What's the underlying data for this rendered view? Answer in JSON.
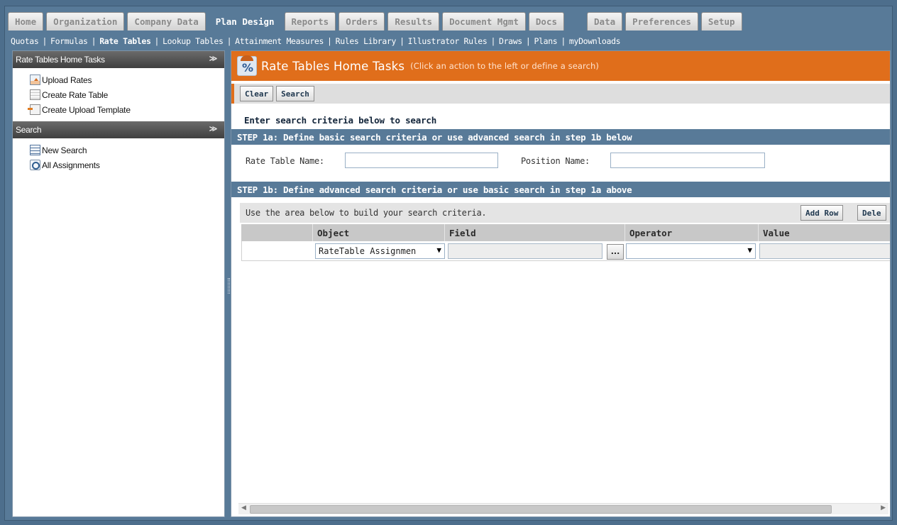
{
  "tabs": [
    {
      "label": "Home",
      "active": false
    },
    {
      "label": "Organization",
      "active": false
    },
    {
      "label": "Company Data",
      "active": false
    },
    {
      "label": "Plan Design",
      "active": true
    },
    {
      "label": "Reports",
      "active": false
    },
    {
      "label": "Orders",
      "active": false
    },
    {
      "label": "Results",
      "active": false
    },
    {
      "label": "Document Mgmt",
      "active": false
    },
    {
      "label": "Docs",
      "active": false
    },
    {
      "label": "Data",
      "active": false
    },
    {
      "label": "Preferences",
      "active": false
    },
    {
      "label": "Setup",
      "active": false
    }
  ],
  "subnav": [
    {
      "label": "Quotas",
      "current": false
    },
    {
      "label": "Formulas",
      "current": false
    },
    {
      "label": "Rate Tables",
      "current": true
    },
    {
      "label": "Lookup Tables",
      "current": false
    },
    {
      "label": "Attainment Measures",
      "current": false
    },
    {
      "label": "Rules Library",
      "current": false
    },
    {
      "label": "Illustrator Rules",
      "current": false
    },
    {
      "label": "Draws",
      "current": false
    },
    {
      "label": "Plans",
      "current": false
    },
    {
      "label": "myDownloads",
      "current": false
    }
  ],
  "left": {
    "tasks_header": "Rate Tables Home Tasks",
    "tasks": [
      {
        "label": "Upload Rates",
        "icon": "upload-icon"
      },
      {
        "label": "Create Rate Table",
        "icon": "document-icon"
      },
      {
        "label": "Create Upload Template",
        "icon": "template-icon"
      }
    ],
    "search_header": "Search",
    "search_items": [
      {
        "label": "New Search",
        "icon": "new-search-icon"
      },
      {
        "label": "All Assignments",
        "icon": "assignments-icon"
      }
    ],
    "collapse_glyph": "≫"
  },
  "main": {
    "title": "Rate Tables Home Tasks",
    "title_hint": "(Click an action to the left or define a search)",
    "clear_label": "Clear",
    "search_label": "Search",
    "instructions": "Enter search criteria below to search",
    "step1a": "STEP 1a: Define basic search criteria or use advanced search in step 1b below",
    "rate_table_name_label": "Rate Table Name:",
    "rate_table_name_value": "",
    "position_name_label": "Position Name:",
    "position_name_value": "",
    "step1b": "STEP 1b: Define advanced search criteria or use basic search in step 1a above",
    "adv_text": "Use the area below to build your search criteria.",
    "add_row_label": "Add Row",
    "delete_label": "Dele",
    "columns": {
      "object": "Object",
      "field": "Field",
      "operator": "Operator",
      "value": "Value"
    },
    "row": {
      "object_value": "RateTable Assignmen",
      "field_value": "",
      "dots_label": "...",
      "operator_value": "",
      "value_value": ""
    }
  },
  "colors": {
    "accent": "#e06e1b",
    "steel_blue": "#587a98"
  }
}
